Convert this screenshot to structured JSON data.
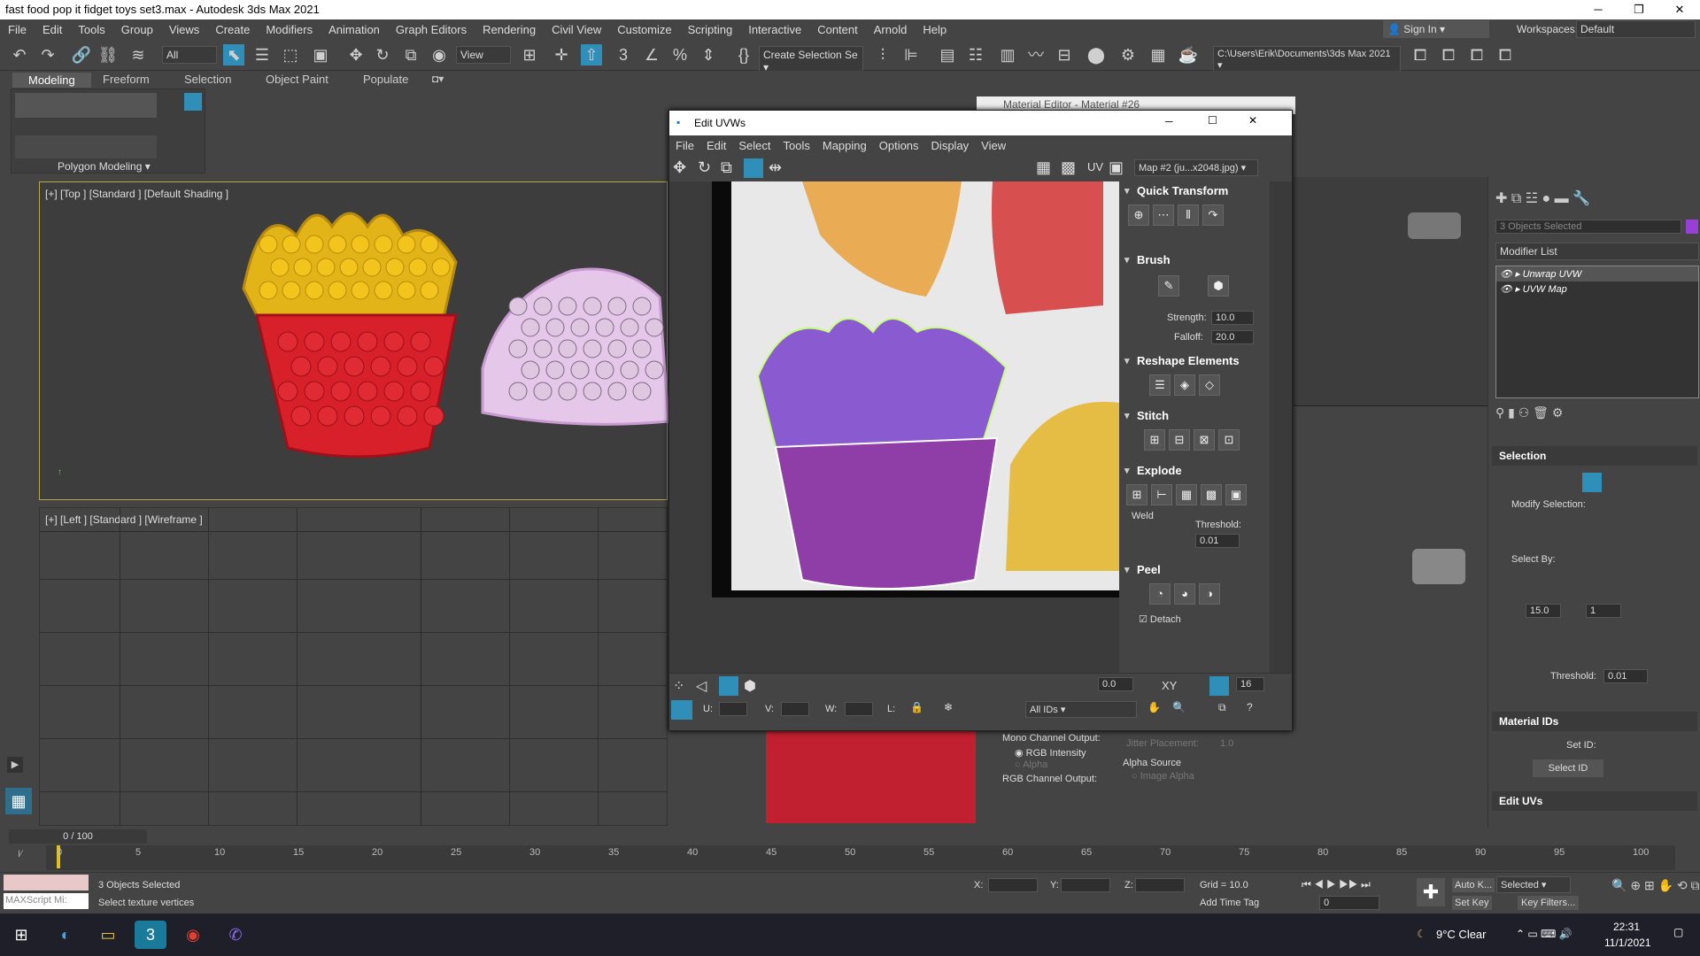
{
  "app": {
    "title": "fast food pop it fidget toys set3.max - Autodesk 3ds Max 2021",
    "window_controls": [
      "─",
      "❐",
      "✕"
    ]
  },
  "menu": [
    "File",
    "Edit",
    "Tools",
    "Group",
    "Views",
    "Create",
    "Modifiers",
    "Animation",
    "Graph Editors",
    "Rendering",
    "Civil View",
    "Customize",
    "Scripting",
    "Interactive",
    "Content",
    "Arnold",
    "Help"
  ],
  "signin": "Sign In",
  "workspace": {
    "label": "Workspaces:",
    "value": "Default"
  },
  "toolbar": {
    "filter": "All",
    "view": "View",
    "selection_set": "Create Selection Se",
    "path": "C:\\Users\\Erik\\Documents\\3ds Max 2021"
  },
  "ribbon": {
    "tabs": [
      "Modeling",
      "Freeform",
      "Selection",
      "Object Paint",
      "Populate"
    ],
    "panel": "Polygon Modeling"
  },
  "viewports": {
    "top": "[+] [Top ] [Standard ] [Default Shading ]",
    "left": "[+] [Left ] [Standard ] [Wireframe ]"
  },
  "material_editor": "Material Editor - Material #26",
  "uv": {
    "title": "Edit UVWs",
    "menu": [
      "File",
      "Edit",
      "Select",
      "Tools",
      "Mapping",
      "Options",
      "Display",
      "View"
    ],
    "uv_label": "UV",
    "map": "Map #2 (ju...x2048.jpg)",
    "panels": {
      "quick": "Quick Transform",
      "brush": "Brush",
      "strength_label": "Strength:",
      "strength": "10.0",
      "falloff_label": "Falloff:",
      "falloff": "20.0",
      "reshape": "Reshape Elements",
      "stitch": "Stitch",
      "explode": "Explode",
      "weld": "Weld",
      "threshold_label": "Threshold:",
      "threshold": "0.01",
      "peel": "Peel",
      "detach": "Detach"
    },
    "bottom": {
      "angle": "0.0",
      "xy": "XY",
      "count": "16",
      "u": "U:",
      "v": "V:",
      "w": "W:",
      "l": "L:",
      "ids": "All IDs"
    }
  },
  "behind": {
    "mono": "Mono Channel Output:",
    "rgb": "RGB Intensity",
    "alpha": "Alpha",
    "rgb_out": "RGB Channel Output:",
    "jitter": "Jitter Placement:",
    "jitter_val": "1.0",
    "alpha_source": "Alpha Source",
    "image_alpha": "Image Alpha"
  },
  "cmd": {
    "objects": "3 Objects Selected",
    "modlist": "Modifier List",
    "stack": [
      "Unwrap UVW",
      "UVW Map"
    ],
    "selection": "Selection",
    "modify_sel": "Modify Selection:",
    "select_by": "Select By:",
    "angle": "15.0",
    "ring": "1",
    "sel_threshold_label": "Threshold:",
    "sel_threshold": "0.01",
    "matids": "Material IDs",
    "setid": "Set ID:",
    "selectid": "Select ID",
    "edituvs": "Edit UVs"
  },
  "timeline": {
    "frame": "0 / 100",
    "ticks": [
      "0",
      "5",
      "10",
      "15",
      "20",
      "25",
      "30",
      "35",
      "40",
      "45",
      "50",
      "55",
      "60",
      "65",
      "70",
      "75",
      "80",
      "85",
      "90",
      "95",
      "100"
    ]
  },
  "status": {
    "maxscript": "MAXScript Mi:",
    "objects": "3 Objects Selected",
    "prompt": "Select texture vertices",
    "x": "X:",
    "y": "Y:",
    "z": "Z:",
    "grid": "Grid = 10.0",
    "addtime": "Add Time Tag",
    "autokey": "Auto K...",
    "selected": "Selected",
    "setkey": "Set Key",
    "keyfilters": "Key Filters...",
    "frame": "0"
  },
  "taskbar": {
    "weather": "9°C  Clear",
    "time": "22:31",
    "date": "11/1/2021"
  }
}
